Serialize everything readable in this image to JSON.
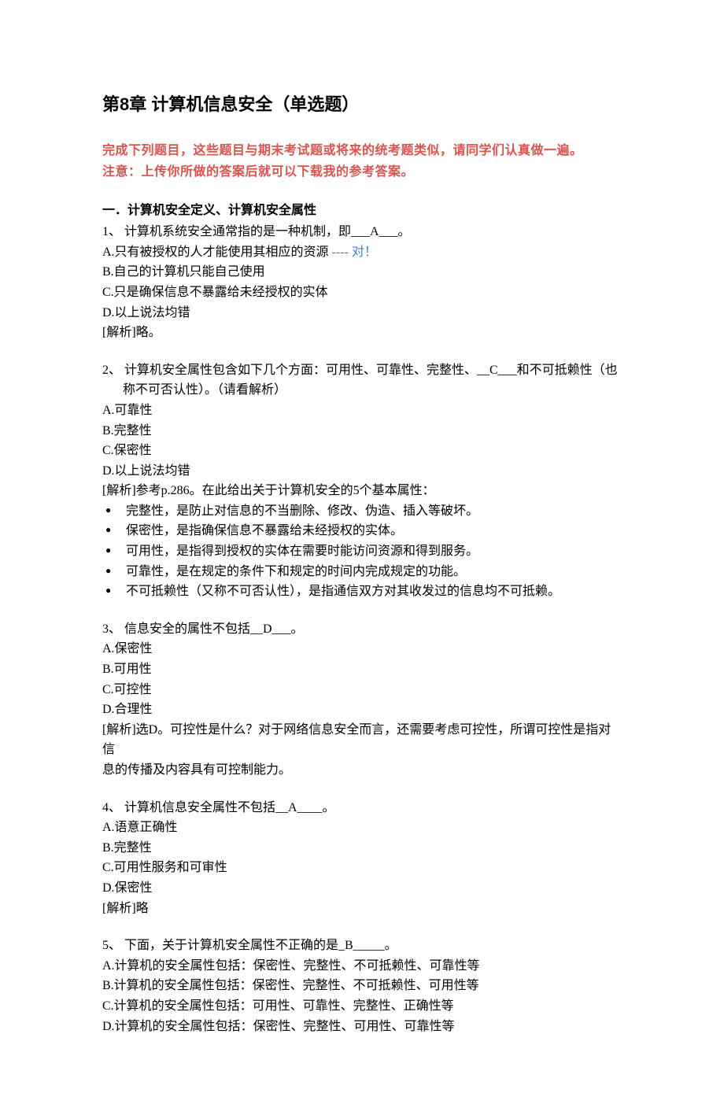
{
  "title": "第8章 计算机信息安全（单选题）",
  "notice_line1": "完成下列题目，这些题目与期末考试题或将来的统考题类似，请同学们认真做一遍。",
  "notice_line2": "注意：上传你所做的答案后就可以下载我的参考答案。",
  "section1_header": "一．计算机安全定义、计算机安全属性",
  "q1": {
    "stem": "1、 计算机系统安全通常指的是一种机制，即___A___。",
    "opt_a_text": "A.只有被授权的人才能使用其相应的资源",
    "opt_a_mark": "   ---- 对！",
    "opt_b": "B.自己的计算机只能自己使用",
    "opt_c": "C.只是确保信息不暴露给未经授权的实体",
    "opt_d": "D.以上说法均错",
    "analysis": "[解析]略。"
  },
  "q2": {
    "stem1": "2、 计算机安全属性包含如下几个方面：可用性、可靠性、完整性、__C___和不可抵赖性（也",
    "stem2": "称不可否认性）。（请看解析）",
    "opt_a": "A.可靠性",
    "opt_b": "B.完整性",
    "opt_c": "C.保密性",
    "opt_d": "D.以上说法均错",
    "analysis_intro": " [解析]参考p.286。在此给出关于计算机安全的5个基本属性：",
    "bullet1": "完整性，是防止对信息的不当删除、修改、伪造、插入等破坏。",
    "bullet2": "保密性，是指确保信息不暴露给未经授权的实体。",
    "bullet3": "可用性，是指得到授权的实体在需要时能访问资源和得到服务。",
    "bullet4": "可靠性，是在规定的条件下和规定的时间内完成规定的功能。",
    "bullet5": "不可抵赖性（又称不可否认性），是指通信双方对其收发过的信息均不可抵赖。"
  },
  "q3": {
    "stem": "3、 信息安全的属性不包括__D___。",
    "opt_a": "A.保密性",
    "opt_b": "B.可用性",
    "opt_c": "C.可控性",
    "opt_d": "D.合理性",
    "analysis1": "[解析]选D。可控性是什么？对于网络信息安全而言，还需要考虑可控性，所谓可控性是指对信",
    "analysis2": "息的传播及内容具有可控制能力。"
  },
  "q4": {
    "stem": "4、 计算机信息安全属性不包括__A____。",
    "opt_a": "A.语意正确性",
    "opt_b": "B.完整性",
    "opt_c": "C.可用性服务和可审性",
    "opt_d": "D.保密性",
    "analysis": "  [解析]略"
  },
  "q5": {
    "stem": "5、 下面，关于计算机安全属性不正确的是_B_____。",
    "opt_a": "A.计算机的安全属性包括：保密性、完整性、不可抵赖性、可靠性等",
    "opt_b": "B.计算机的安全属性包括：保密性、完整性、不可抵赖性、可用性等",
    "opt_c": "C.计算机的安全属性包括：可用性、可靠性、完整性、正确性等",
    "opt_d": "D.计算机的安全属性包括：保密性、完整性、可用性、可靠性等"
  }
}
